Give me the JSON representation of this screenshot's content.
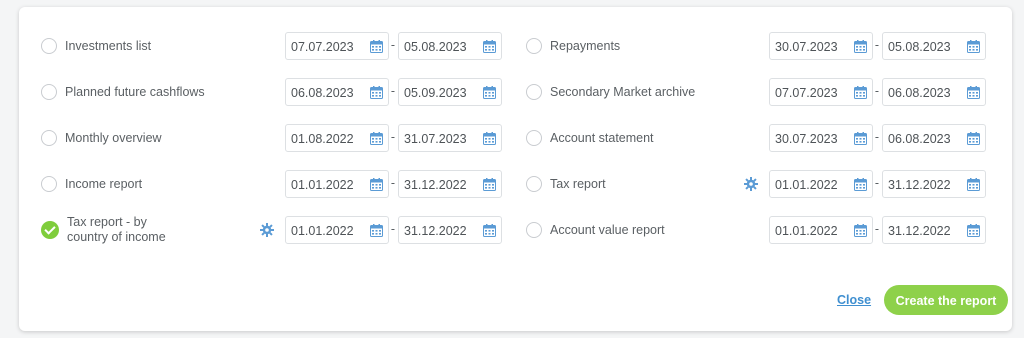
{
  "left_reports": [
    {
      "label": "Investments list",
      "checked": false,
      "from": "07.07.2023",
      "to": "05.08.2023",
      "settings": false
    },
    {
      "label": "Planned future cashflows",
      "checked": false,
      "from": "06.08.2023",
      "to": "05.09.2023",
      "settings": false
    },
    {
      "label": "Monthly overview",
      "checked": false,
      "from": "01.08.2022",
      "to": "31.07.2023",
      "settings": false
    },
    {
      "label": "Income report",
      "checked": false,
      "from": "01.01.2022",
      "to": "31.12.2022",
      "settings": false
    },
    {
      "label": "Tax report - by country of income",
      "checked": true,
      "from": "01.01.2022",
      "to": "31.12.2022",
      "settings": true
    }
  ],
  "right_reports": [
    {
      "label": "Repayments",
      "checked": false,
      "from": "30.07.2023",
      "to": "05.08.2023",
      "settings": false
    },
    {
      "label": "Secondary Market archive",
      "checked": false,
      "from": "07.07.2023",
      "to": "06.08.2023",
      "settings": false
    },
    {
      "label": "Account statement",
      "checked": false,
      "from": "30.07.2023",
      "to": "06.08.2023",
      "settings": false
    },
    {
      "label": "Tax report",
      "checked": false,
      "from": "01.01.2022",
      "to": "31.12.2022",
      "settings": true
    },
    {
      "label": "Account value report",
      "checked": false,
      "from": "01.01.2022",
      "to": "31.12.2022",
      "settings": false
    }
  ],
  "range_separator": "-",
  "actions": {
    "close_label": "Close",
    "create_label": "Create the report"
  },
  "colors": {
    "accent_green": "#8ed14a",
    "link_blue": "#3f8fd0",
    "icon_blue": "#5b9bd5"
  }
}
